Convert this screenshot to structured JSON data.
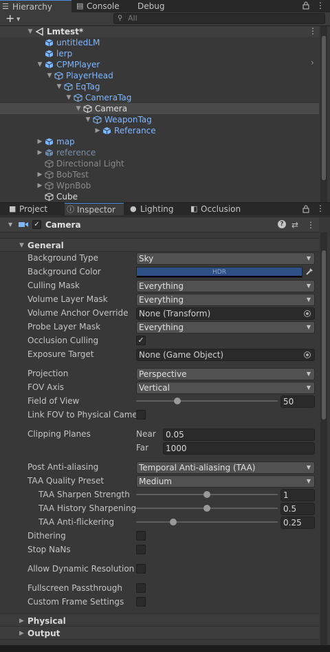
{
  "hierarchy_tabs": [
    {
      "icon": "☰",
      "label": "Hierarchy"
    },
    {
      "icon": "▤",
      "label": "Console"
    },
    {
      "icon": "",
      "label": "Debug"
    }
  ],
  "search": {
    "placeholder": "All"
  },
  "tree": [
    {
      "label": "Lmtest*",
      "depth": 0,
      "arrow": "▼",
      "color": "white",
      "kind": "scene"
    },
    {
      "label": "untitledLM",
      "depth": 1,
      "arrow": "",
      "color": "blue",
      "kind": "prefab"
    },
    {
      "label": "lerp",
      "depth": 1,
      "arrow": "",
      "color": "blue",
      "kind": "prefab"
    },
    {
      "label": "CPMPlayer",
      "depth": 1,
      "arrow": "▼",
      "color": "blue",
      "kind": "prefab"
    },
    {
      "label": "PlayerHead",
      "depth": 2,
      "arrow": "▼",
      "color": "blue",
      "kind": "go"
    },
    {
      "label": "EqTag",
      "depth": 3,
      "arrow": "▼",
      "color": "blue",
      "kind": "go"
    },
    {
      "label": "CameraTag",
      "depth": 4,
      "arrow": "▼",
      "color": "blue",
      "kind": "go"
    },
    {
      "label": "Camera",
      "depth": 5,
      "arrow": "▼",
      "color": "white",
      "kind": "go"
    },
    {
      "label": "WeaponTag",
      "depth": 6,
      "arrow": "▼",
      "color": "blue",
      "kind": "go"
    },
    {
      "label": "Referance",
      "depth": 7,
      "arrow": "▶",
      "color": "blue",
      "kind": "prefab"
    },
    {
      "label": "map",
      "depth": 1,
      "arrow": "▶",
      "color": "blue",
      "kind": "prefab"
    },
    {
      "label": "reference",
      "depth": 1,
      "arrow": "▶",
      "color": "dim",
      "kind": "prefab"
    },
    {
      "label": "Directional Light",
      "depth": 1,
      "arrow": "",
      "color": "grey",
      "kind": "go"
    },
    {
      "label": "BobTest",
      "depth": 1,
      "arrow": "▶",
      "color": "grey",
      "kind": "go"
    },
    {
      "label": "WpnBob",
      "depth": 1,
      "arrow": "▶",
      "color": "grey",
      "kind": "go"
    },
    {
      "label": "Cube",
      "depth": 1,
      "arrow": "",
      "color": "white",
      "kind": "go"
    }
  ],
  "inspector_tabs": [
    {
      "icon": "■",
      "label": "Project"
    },
    {
      "icon": "ⓘ",
      "label": "Inspector"
    },
    {
      "icon": "●",
      "label": "Lighting"
    },
    {
      "icon": "◧",
      "label": "Occlusion"
    }
  ],
  "component": {
    "name": "Camera",
    "enabled_mark": "✓"
  },
  "sections": {
    "general": "General",
    "physical": "Physical",
    "output": "Output"
  },
  "props": {
    "background_type": {
      "label": "Background Type",
      "value": "Sky"
    },
    "background_color": {
      "label": "Background Color",
      "badge": "HDR"
    },
    "culling_mask": {
      "label": "Culling Mask",
      "value": "Everything"
    },
    "volume_layer_mask": {
      "label": "Volume Layer Mask",
      "value": "Everything"
    },
    "volume_anchor_override": {
      "label": "Volume Anchor Override",
      "value": "None (Transform)"
    },
    "probe_layer_mask": {
      "label": "Probe Layer Mask",
      "value": "Everything"
    },
    "occlusion_culling": {
      "label": "Occlusion Culling",
      "mark": "✓",
      "checked": true
    },
    "exposure_target": {
      "label": "Exposure Target",
      "value": "None (Game Object)"
    },
    "projection": {
      "label": "Projection",
      "value": "Perspective"
    },
    "fov_axis": {
      "label": "FOV Axis",
      "value": "Vertical"
    },
    "field_of_view": {
      "label": "Field of View",
      "value": "50",
      "slider_fraction": 0.29
    },
    "link_fov": {
      "label": "Link FOV to Physical Camer",
      "checked": false
    },
    "clipping_planes": {
      "label": "Clipping Planes",
      "near_label": "Near",
      "near": "0.05",
      "far_label": "Far",
      "far": "1000"
    },
    "post_aa": {
      "label": "Post Anti-aliasing",
      "value": "Temporal Anti-aliasing (TAA)"
    },
    "taa_quality": {
      "label": "TAA Quality Preset",
      "value": "Medium"
    },
    "taa_sharpen": {
      "label": "TAA Sharpen Strength",
      "value": "1",
      "slider_fraction": 0.5
    },
    "taa_history": {
      "label": "TAA History Sharpening",
      "value": "0.5",
      "slider_fraction": 0.5
    },
    "taa_antiflicker": {
      "label": "TAA Anti-flickering",
      "value": "0.25",
      "slider_fraction": 0.26
    },
    "dithering": {
      "label": "Dithering",
      "checked": false
    },
    "stop_nans": {
      "label": "Stop NaNs",
      "checked": false
    },
    "dynamic_res": {
      "label": "Allow Dynamic Resolution",
      "checked": false
    },
    "fullscreen_pass": {
      "label": "Fullscreen Passthrough",
      "checked": false
    },
    "custom_frame": {
      "label": "Custom Frame Settings",
      "checked": false
    }
  },
  "colors": {
    "accent": "#4b8ee6",
    "prefab": "#7eb6ff",
    "bg": "#383838",
    "hdr_color": "#2d4f86"
  }
}
